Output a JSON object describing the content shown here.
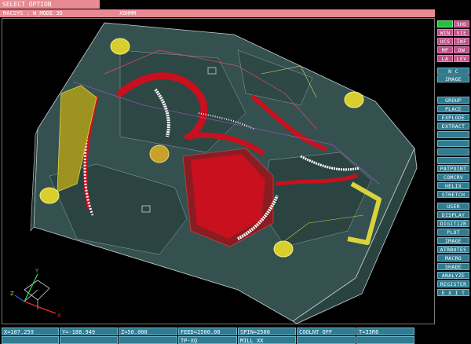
{
  "top_tab": "SELECT OPTION",
  "mode_bar": {
    "mode": "MACSYS : W_MODE 3D",
    "view": "XOHMM"
  },
  "side_menu": {
    "grid_buttons": [
      "",
      "SHD",
      "WIN",
      "VIE",
      "UCS",
      "INF",
      "MP",
      "DW",
      "LA",
      "LEV"
    ],
    "nc": "N C",
    "image": "IMAGE",
    "group_items": [
      "GROUP",
      "PLACE",
      "EXPLODE",
      "EXTRACT",
      "",
      "",
      "",
      ""
    ],
    "pattern_items": [
      "PATPOINT",
      "COMCRV",
      "HELIX",
      "STRETCH"
    ],
    "main_items": [
      "USER",
      "DISPLAY",
      "DIGITIZR",
      "PLOT",
      "IMAGE",
      "ATRBUTES",
      "MACRO",
      "SHADE",
      "ANALYZE",
      "REGISTER",
      "E X I T"
    ]
  },
  "status": {
    "row1": [
      "X=107.259",
      "Y=-188.949",
      "Z=50.000",
      "FEED=2500.00",
      "SPIN=2500",
      "COOLNT OFF",
      "T=33R6"
    ],
    "row2": [
      "",
      "",
      "",
      "TP-XQ",
      "MILL XX",
      "",
      ""
    ]
  },
  "axis_labels": {
    "x": "X",
    "y": "Y",
    "z": "Z"
  },
  "colors": {
    "menu_teal": "#2f7b91",
    "menu_pink": "#c24e8a",
    "title_pink": "#e98a93",
    "part_gray": "#34514f",
    "toolpath_red": "#c8101e"
  }
}
